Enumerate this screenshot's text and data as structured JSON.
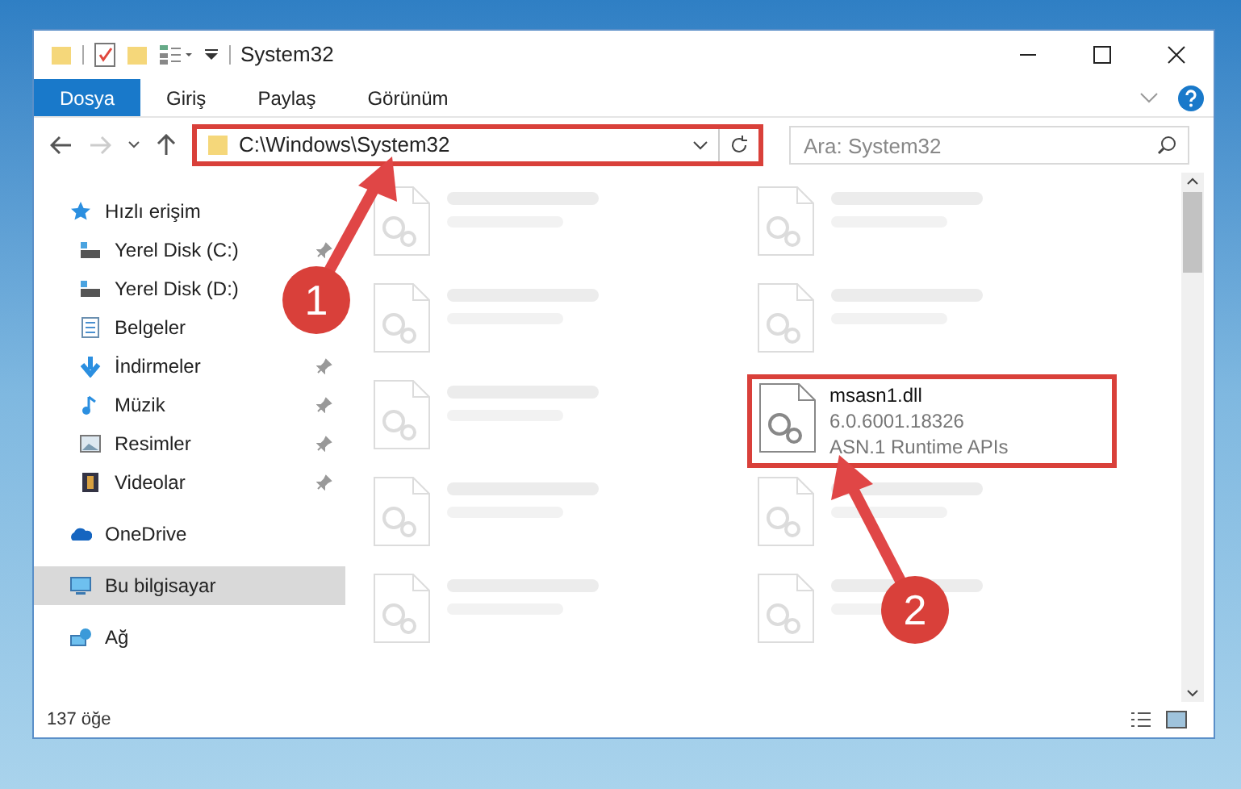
{
  "window": {
    "title": "System32"
  },
  "ribbon_tabs": [
    {
      "label": "Dosya",
      "selected": true
    },
    {
      "label": "Giriş",
      "selected": false
    },
    {
      "label": "Paylaş",
      "selected": false
    },
    {
      "label": "Görünüm",
      "selected": false
    }
  ],
  "address": {
    "value": "C:\\Windows\\System32",
    "highlighted": true
  },
  "search": {
    "placeholder": "Ara: System32"
  },
  "nav": [
    {
      "label": "Hızlı erişim",
      "kind": "star",
      "pinned": false,
      "selected": false,
      "children": [
        {
          "label": "Yerel Disk (C:)",
          "kind": "disk",
          "pinned": true,
          "selected": false
        },
        {
          "label": "Yerel Disk (D:)",
          "kind": "disk",
          "pinned": false,
          "selected": false
        },
        {
          "label": "Belgeler",
          "kind": "doc",
          "pinned": false,
          "selected": false
        },
        {
          "label": "İndirmeler",
          "kind": "download",
          "pinned": true,
          "selected": false
        },
        {
          "label": "Müzik",
          "kind": "music",
          "pinned": true,
          "selected": false
        },
        {
          "label": "Resimler",
          "kind": "picture",
          "pinned": true,
          "selected": false
        },
        {
          "label": "Videolar",
          "kind": "video",
          "pinned": true,
          "selected": false
        }
      ]
    },
    {
      "label": "OneDrive",
      "kind": "cloud",
      "pinned": false,
      "selected": false
    },
    {
      "label": "Bu bilgisayar",
      "kind": "pc",
      "pinned": false,
      "selected": true
    },
    {
      "label": "Ağ",
      "kind": "network",
      "pinned": false,
      "selected": false
    }
  ],
  "files": [
    {
      "kind": "blurred"
    },
    {
      "kind": "blurred"
    },
    {
      "kind": "blurred"
    },
    {
      "kind": "blurred"
    },
    {
      "kind": "blurred"
    },
    {
      "kind": "file",
      "name": "msasn1.dll",
      "line_2": "6.0.6001.18326",
      "line_3": "ASN.1 Runtime APIs",
      "highlighted": true
    },
    {
      "kind": "blurred"
    },
    {
      "kind": "blurred"
    },
    {
      "kind": "blurred"
    },
    {
      "kind": "blurred"
    }
  ],
  "status_bar": {
    "count": "137 öğe"
  },
  "annotations": [
    {
      "label": "1"
    },
    {
      "label": "2"
    }
  ]
}
